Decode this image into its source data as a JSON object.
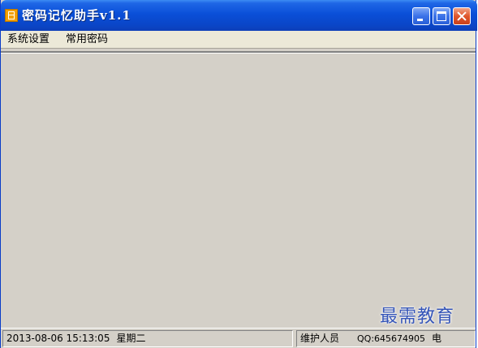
{
  "window": {
    "title": "密码记忆助手v1.1"
  },
  "menu": {
    "items": [
      {
        "label": "系统设置"
      },
      {
        "label": "常用密码"
      }
    ]
  },
  "status": {
    "datetime": "2013-08-06 15:13:05",
    "weekday": "星期二",
    "maintainer_label": "维护人员",
    "qq": "QQ:645674905",
    "extra": "电"
  },
  "watermark": {
    "text": "最需教育"
  },
  "colors": {
    "titlebar": "#0a4fd8",
    "window_bg": "#d4d0c8",
    "close_button": "#e0562c",
    "watermark": "#2d4fb8"
  },
  "icons": {
    "app": "app-icon",
    "minimize": "minimize-icon",
    "maximize": "maximize-icon",
    "close": "close-icon"
  }
}
